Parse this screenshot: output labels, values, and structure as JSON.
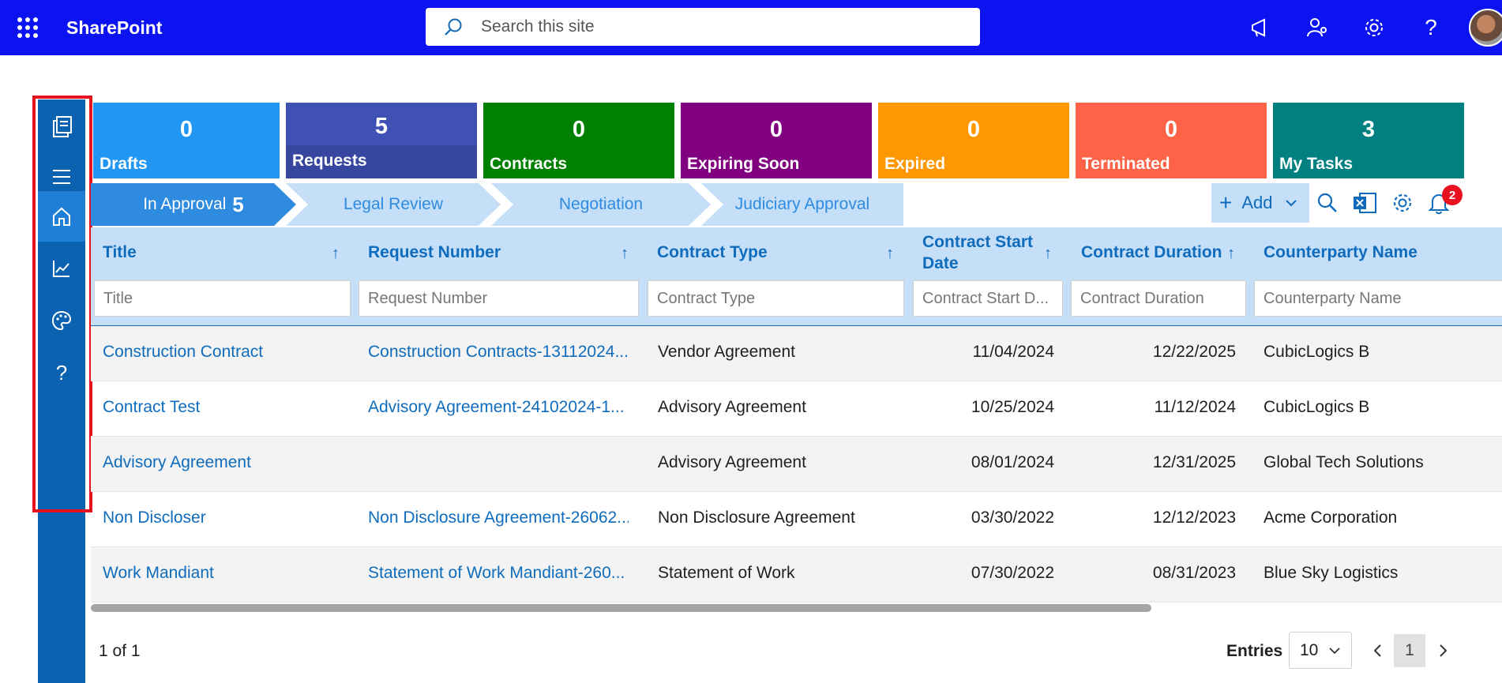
{
  "app": {
    "title": "SharePoint"
  },
  "search": {
    "placeholder": "Search this site"
  },
  "header_icons": [
    "megaphone-icon",
    "people-settings-icon",
    "gear-icon",
    "help-icon",
    "avatar"
  ],
  "nav": {
    "items": [
      "documents-icon",
      "menu-icon",
      "home-icon",
      "chart-icon",
      "palette-icon",
      "help-icon"
    ],
    "active": "home"
  },
  "tiles": [
    {
      "count": "0",
      "label": "Drafts",
      "color": "#2196f3"
    },
    {
      "count": "5",
      "label": "Requests",
      "color": "#3f51b5"
    },
    {
      "count": "0",
      "label": "Contracts",
      "color": "#008000"
    },
    {
      "count": "0",
      "label": "Expiring Soon",
      "color": "#800080"
    },
    {
      "count": "0",
      "label": "Expired",
      "color": "#ff9800"
    },
    {
      "count": "0",
      "label": "Terminated",
      "color": "#ff6347"
    },
    {
      "count": "3",
      "label": "My Tasks",
      "color": "#008080"
    }
  ],
  "stages": [
    {
      "label": "In Approval",
      "count": "5"
    },
    {
      "label": "Legal Review"
    },
    {
      "label": "Negotiation"
    },
    {
      "label": "Judiciary Approval"
    }
  ],
  "toolbar": {
    "add_label": "Add",
    "notifications_count": "2"
  },
  "columns": [
    {
      "label": "Title",
      "filter": "Title"
    },
    {
      "label": "Request Number",
      "filter": "Request Number"
    },
    {
      "label": "Contract Type",
      "filter": "Contract Type"
    },
    {
      "label": "Contract Start Date",
      "filter": "Contract Start D..."
    },
    {
      "label": "Contract Duration",
      "filter": "Contract Duration"
    },
    {
      "label": "Counterparty Name",
      "filter": "Counterparty Name"
    }
  ],
  "rows": [
    {
      "title": "Construction Contract",
      "request": "Construction Contracts-13112024...",
      "type": "Vendor Agreement",
      "start": "11/04/2024",
      "duration": "12/22/2025",
      "party": "CubicLogics B"
    },
    {
      "title": "Contract Test",
      "request": "Advisory Agreement-24102024-1...",
      "type": "Advisory Agreement",
      "start": "10/25/2024",
      "duration": "11/12/2024",
      "party": "CubicLogics B"
    },
    {
      "title": "Advisory Agreement",
      "request": "",
      "type": "Advisory Agreement",
      "start": "08/01/2024",
      "duration": "12/31/2025",
      "party": "Global Tech Solutions"
    },
    {
      "title": "Non Discloser",
      "request": "Non Disclosure Agreement-26062...",
      "type": "Non Disclosure Agreement",
      "start": "03/30/2022",
      "duration": "12/12/2023",
      "party": "Acme Corporation"
    },
    {
      "title": "Work Mandiant",
      "request": "Statement of Work Mandiant-260...",
      "type": "Statement of Work",
      "start": "07/30/2022",
      "duration": "08/31/2023",
      "party": "Blue Sky Logistics"
    }
  ],
  "pager": {
    "summary": "1 of 1",
    "entries_label": "Entries",
    "entries_value": "10",
    "current_page": "1"
  }
}
